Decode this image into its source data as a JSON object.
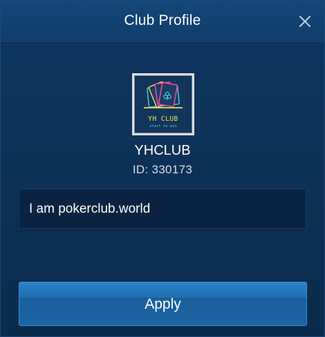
{
  "dialog": {
    "title": "Club Profile"
  },
  "club": {
    "logo_title": "YH CLUB",
    "logo_subtitle": "start to win",
    "name": "YHCLUB",
    "id_text": "ID: 330173",
    "description": "I am pokerclub.world"
  },
  "actions": {
    "apply_label": "Apply"
  },
  "colors": {
    "background": "#0d3054",
    "header": "#14477a",
    "button": "#1f6fb2",
    "logo_neon_pink": "#ff4fa0",
    "logo_neon_cyan": "#4fd0e0",
    "logo_neon_yellow": "#f2e45c"
  }
}
